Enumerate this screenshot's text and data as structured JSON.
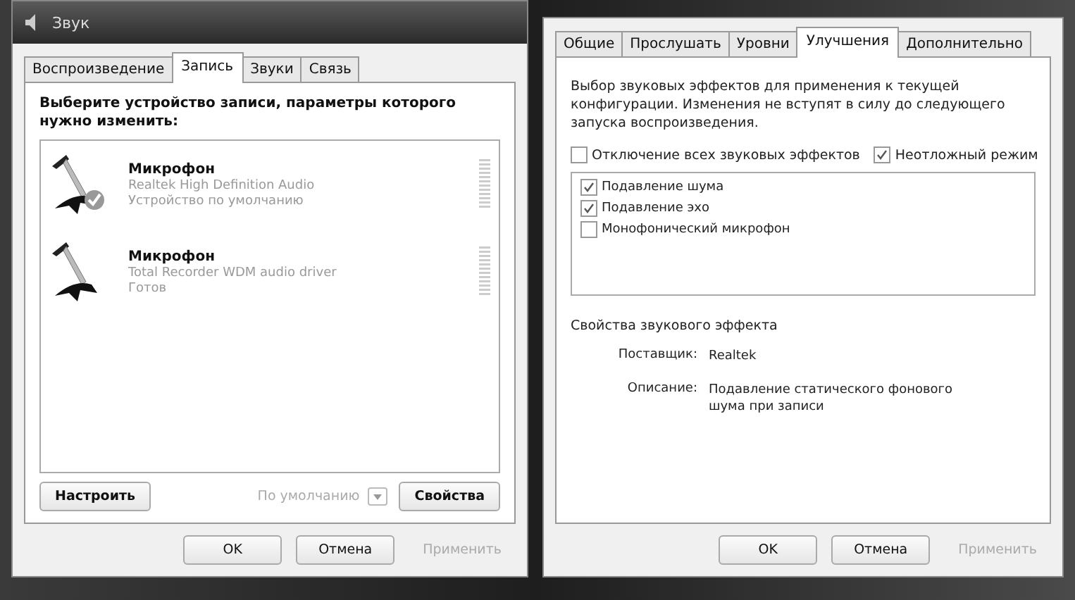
{
  "left_dialog": {
    "title": "Звук",
    "tabs": [
      {
        "label": "Воспроизведение",
        "selected": false
      },
      {
        "label": "Запись",
        "selected": true
      },
      {
        "label": "Звуки",
        "selected": false
      },
      {
        "label": "Связь",
        "selected": false
      }
    ],
    "prompt": "Выберите устройство записи, параметры которого нужно изменить:",
    "devices": [
      {
        "name": "Микрофон",
        "driver": "Realtek High Definition Audio",
        "status": "Устройство по умолчанию",
        "default": true
      },
      {
        "name": "Микрофон",
        "driver": "Total Recorder WDM audio driver",
        "status": "Готов",
        "default": false
      }
    ],
    "buttons": [
      {
        "label": "Настроить",
        "kind": "button",
        "disabled": false
      },
      {
        "label": "По умолчанию",
        "kind": "split",
        "disabled": true
      },
      {
        "label": "Свойства",
        "kind": "button",
        "disabled": false
      }
    ],
    "footer_buttons": [
      {
        "label": "OK",
        "disabled": false
      },
      {
        "label": "Отмена",
        "disabled": false
      },
      {
        "label": "Применить",
        "disabled": true
      }
    ]
  },
  "right_dialog": {
    "tabs": [
      {
        "label": "Общие",
        "selected": false
      },
      {
        "label": "Прослушать",
        "selected": false
      },
      {
        "label": "Уровни",
        "selected": false
      },
      {
        "label": "Улучшения",
        "selected": true
      },
      {
        "label": "Дополнительно",
        "selected": false
      }
    ],
    "description": "Выбор звуковых эффектов для применения к текущей конфигурации. Изменения не вступят в силу до следующего запуска воспроизведения.",
    "options": [
      {
        "label": "Отключение всех звуковых эффектов",
        "checked": false
      },
      {
        "label": "Неотложный режим",
        "checked": true
      }
    ],
    "effects": [
      {
        "label": "Подавление шума",
        "checked": true
      },
      {
        "label": "Подавление эхо",
        "checked": true
      },
      {
        "label": "Монофонический микрофон",
        "checked": false
      }
    ],
    "properties_title": "Свойства звукового эффекта",
    "properties": [
      {
        "label": "Поставщик:",
        "value": "Realtek"
      },
      {
        "label": "Описание:",
        "value": "Подавление статического фонового шума при записи"
      }
    ],
    "footer_buttons": [
      {
        "label": "OK",
        "disabled": false
      },
      {
        "label": "Отмена",
        "disabled": false
      },
      {
        "label": "Применить",
        "disabled": true
      }
    ]
  }
}
